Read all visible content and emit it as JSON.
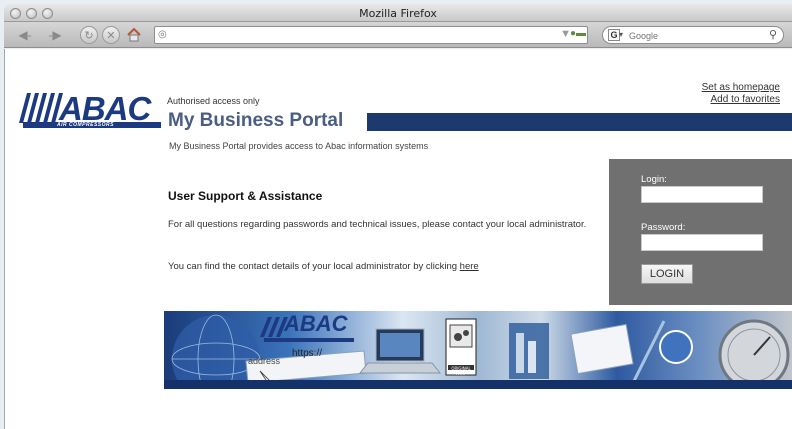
{
  "window": {
    "title": "Mozilla Firefox"
  },
  "toolbar": {
    "search_placeholder": "Google"
  },
  "page": {
    "logo": {
      "name": "ABAC",
      "tagline": "AIR COMPRESSORS"
    },
    "auth_notice": "Authorised access only",
    "portal_title": "My Business Portal",
    "portal_description": "My Business Portal provides access to Abac information systems",
    "links": {
      "homepage": "Set as homepage",
      "favorites": "Add to favorites"
    },
    "support": {
      "heading": "User Support & Assistance",
      "paragraph1": "For all questions regarding passwords and technical issues, please contact your local administrator.",
      "paragraph2_prefix": "You can find the contact details of your local administrator by clicking ",
      "paragraph2_link": "here"
    },
    "login": {
      "login_label": "Login:",
      "password_label": "Password:",
      "button": "LOGIN"
    },
    "banner": {
      "logo": "ABAC",
      "address_text": "address",
      "url_text": "https://",
      "part_label": "ORIGINAL PART"
    }
  }
}
